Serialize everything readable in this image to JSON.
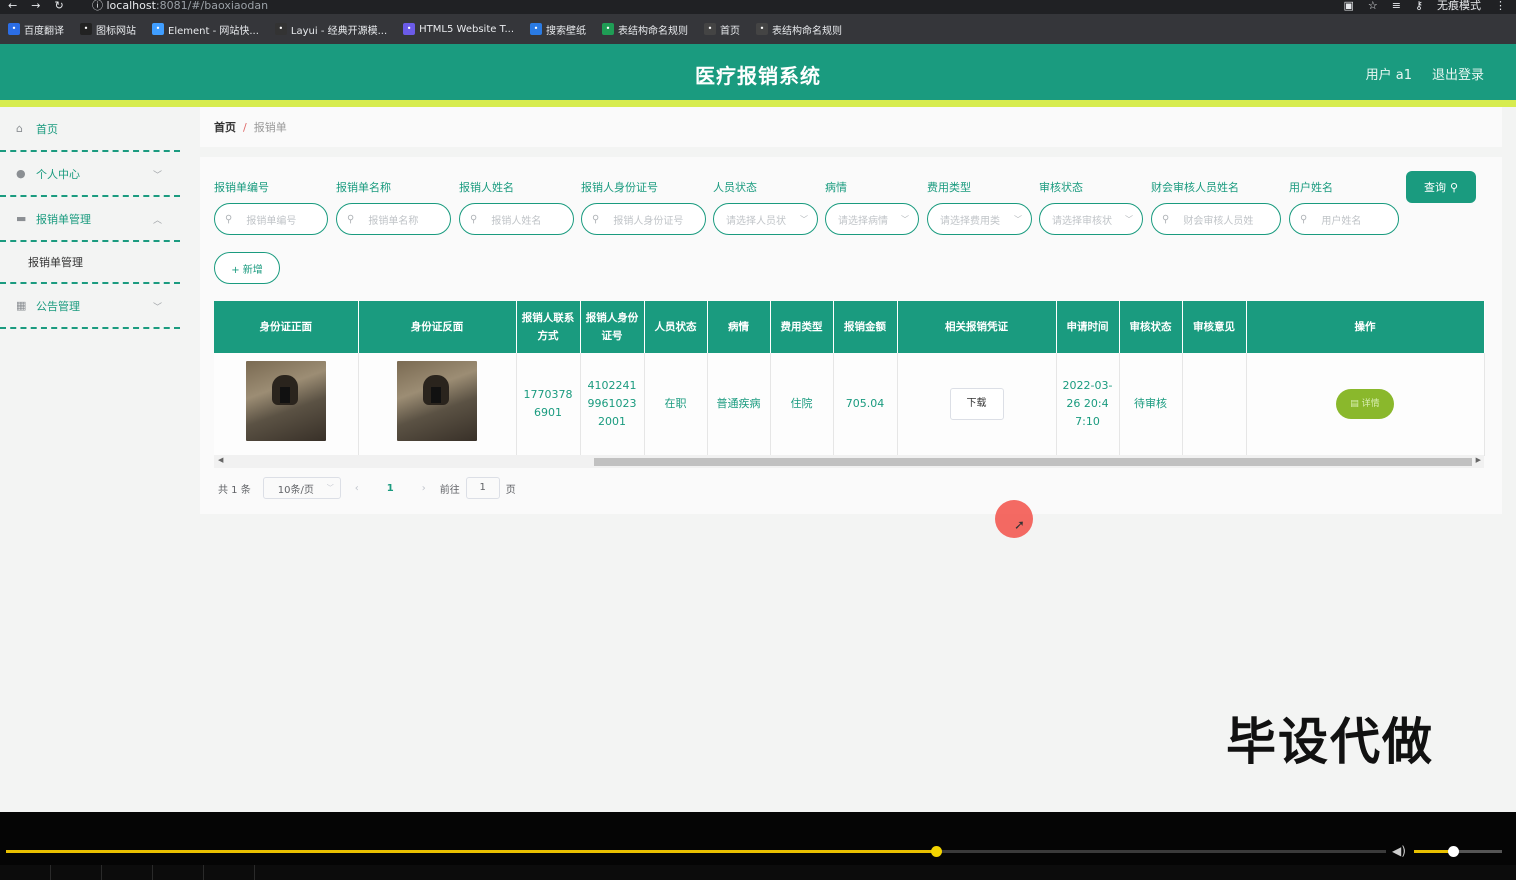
{
  "browser": {
    "url_host": "localhost",
    "url_rest": ":8081/#/baoxiaodan",
    "incognito_label": "无痕模式",
    "bookmarks": [
      {
        "label": "百度翻译",
        "color": "#2b6de5"
      },
      {
        "label": "图标网站",
        "color": "#222"
      },
      {
        "label": "Element - 网站快...",
        "color": "#409eff"
      },
      {
        "label": "Layui - 经典开源模...",
        "color": "#333"
      },
      {
        "label": "HTML5 Website T...",
        "color": "#6b5be8"
      },
      {
        "label": "搜索壁纸",
        "color": "#2a7be4"
      },
      {
        "label": "表结构命名规则",
        "color": "#1f9d55"
      },
      {
        "label": "首页",
        "color": "#444"
      },
      {
        "label": "表结构命名规则",
        "color": "#444"
      }
    ]
  },
  "header": {
    "title": "医疗报销系统",
    "user": "用户 a1",
    "logout": "退出登录"
  },
  "sidebar": {
    "items": [
      {
        "label": "首页",
        "icon": "home-icon"
      },
      {
        "label": "个人中心",
        "icon": "user-icon"
      },
      {
        "label": "报销单管理",
        "icon": "briefcase-icon"
      },
      {
        "label": "报销单管理"
      },
      {
        "label": "公告管理",
        "icon": "grid-icon"
      }
    ]
  },
  "breadcrumb": {
    "home": "首页",
    "sep": "/",
    "current": "报销单"
  },
  "filters": [
    {
      "label": "报销单编号",
      "placeholder": "报销单编号"
    },
    {
      "label": "报销单名称",
      "placeholder": "报销单名称"
    },
    {
      "label": "报销人姓名",
      "placeholder": "报销人姓名"
    },
    {
      "label": "报销人身份证号",
      "placeholder": "报销人身份证号"
    },
    {
      "label": "人员状态",
      "placeholder": "请选择人员状"
    },
    {
      "label": "病情",
      "placeholder": "请选择病情"
    },
    {
      "label": "费用类型",
      "placeholder": "请选择费用类"
    },
    {
      "label": "审核状态",
      "placeholder": "请选择审核状"
    },
    {
      "label": "财会审核人员姓名",
      "placeholder": "财会审核人员姓"
    },
    {
      "label": "用户姓名",
      "placeholder": "用户姓名"
    }
  ],
  "buttons": {
    "query": "查询",
    "add": "+ 新增",
    "download": "下载",
    "detail": "详情"
  },
  "table": {
    "headers": [
      "身份证正面",
      "身份证反面",
      "报销人联系方式",
      "报销人身份证号",
      "人员状态",
      "病情",
      "费用类型",
      "报销金额",
      "相关报销凭证",
      "申请时间",
      "审核状态",
      "审核意见",
      "操作"
    ],
    "row": {
      "phone": "17703786901",
      "idno": "410224199610232001",
      "status": "在职",
      "illness": "普通疾病",
      "fee_type": "住院",
      "amount": "705.04",
      "apply_time": "2022-03-26 20:47:10",
      "audit_status": "待审核",
      "audit_opinion": ""
    }
  },
  "pager": {
    "total": "共 1 条",
    "page_size": "10条/页",
    "current": "1",
    "goto": "前往",
    "goto_val": "1",
    "page_unit": "页"
  },
  "watermark": "毕设代做",
  "colors": {
    "primary": "#1a9b7f",
    "accent": "#d7ec4f",
    "detail": "#8ab82c"
  }
}
